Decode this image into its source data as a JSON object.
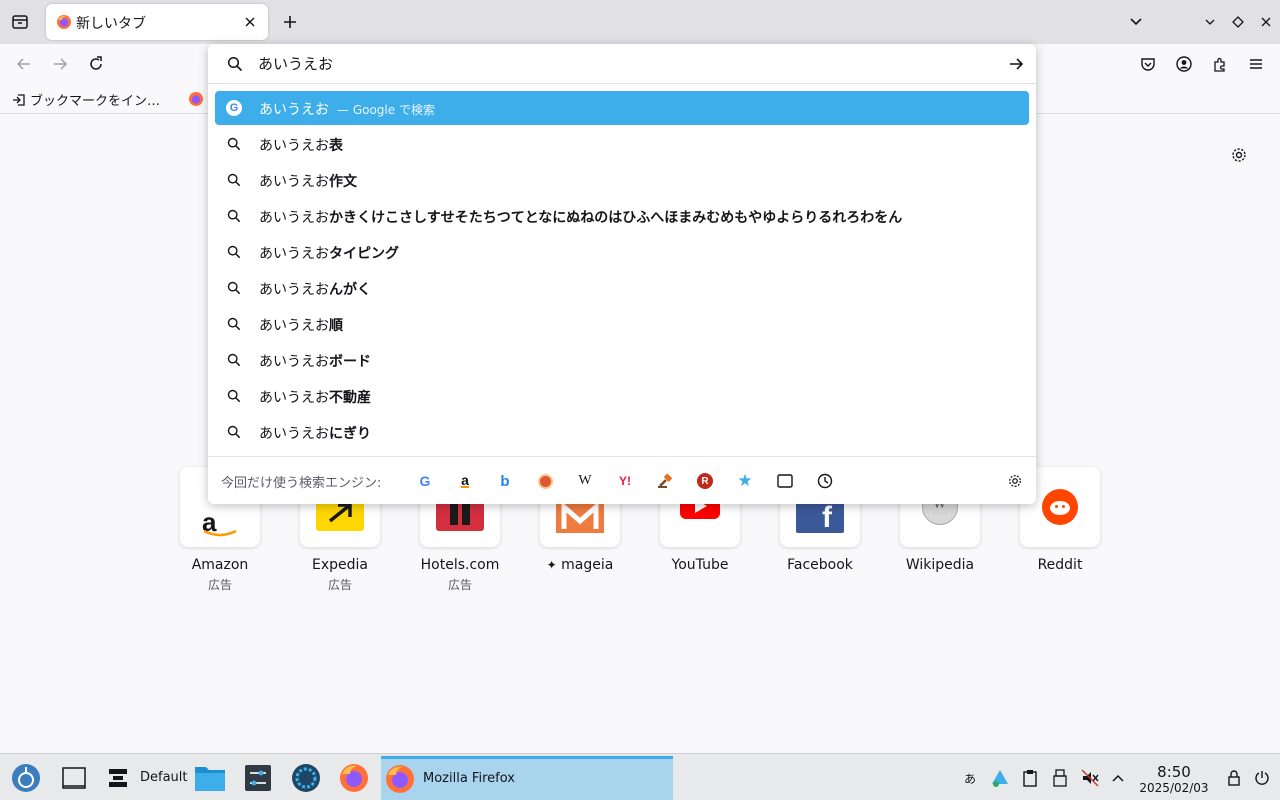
{
  "tab": {
    "title": "新しいタブ"
  },
  "bookmarks": {
    "import_label": "ブックマークをイン…"
  },
  "urlbar": {
    "input_value": "あいうえお",
    "suggestions": [
      {
        "prefix": "あいうえお",
        "bold": "",
        "engine_hint": "— Google で検索"
      },
      {
        "prefix": "あいうえお",
        "bold": "表"
      },
      {
        "prefix": "あいうえお",
        "bold": "作文"
      },
      {
        "prefix": "あいうえお",
        "bold": "かきくけこさしすせそたちつてとなにぬねのはひふへほまみむめもやゆよらりるれろわをん"
      },
      {
        "prefix": "あいうえお",
        "bold": "タイピング"
      },
      {
        "prefix": "あいうえお",
        "bold": "んがく"
      },
      {
        "prefix": "あいうえお",
        "bold": "順"
      },
      {
        "prefix": "あいうえお",
        "bold": "ボード"
      },
      {
        "prefix": "あいうえお",
        "bold": "不動産"
      },
      {
        "prefix": "あいうえお",
        "bold": "にぎり"
      }
    ],
    "one_off_label": "今回だけ使う検索エンジン:",
    "engines": [
      "google-icon",
      "amazon-icon",
      "bing-icon",
      "duckduckgo-icon",
      "wikipedia-icon",
      "yahoo-icon",
      "auction-icon",
      "rakuten-icon",
      "bookmarks-icon",
      "tabs-icon",
      "history-icon"
    ]
  },
  "tiles": [
    {
      "label": "Amazon",
      "sub": "広告"
    },
    {
      "label": "Expedia",
      "sub": "広告"
    },
    {
      "label": "Hotels.com",
      "sub": "広告"
    },
    {
      "label": "mageia",
      "sub": ""
    },
    {
      "label": "YouTube",
      "sub": ""
    },
    {
      "label": "Facebook",
      "sub": ""
    },
    {
      "label": "Wikipedia",
      "sub": ""
    },
    {
      "label": "Reddit",
      "sub": ""
    }
  ],
  "taskbar": {
    "desktop_label": "Default",
    "active_window": "Mozilla Firefox",
    "ime": "あ",
    "time": "8:50",
    "date": "2025/02/03"
  },
  "colors": {
    "accent": "#3daee9",
    "taskbar_active": "#a8d4ee"
  }
}
